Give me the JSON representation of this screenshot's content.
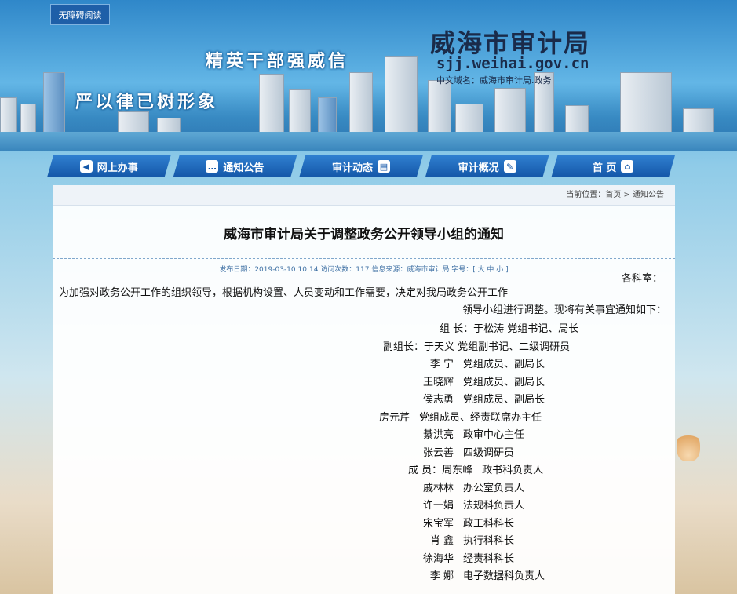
{
  "header": {
    "accessibility_label": "无障碍阅读",
    "site_name": "威海市审计局",
    "domain": "sjj.weihai.gov.cn",
    "cn_domain": "中文域名：威海市审计局.政务",
    "slogan_1": "精英干部强威信",
    "slogan_2": "严以律已树形象"
  },
  "nav": {
    "items": [
      {
        "label": "首  页",
        "icon": "home-icon"
      },
      {
        "label": "审计概况",
        "icon": "profile-icon"
      },
      {
        "label": "审计动态",
        "icon": "book-icon"
      },
      {
        "label": "通知公告",
        "icon": "chat-icon"
      },
      {
        "label": "网上办事",
        "icon": "speaker-icon"
      }
    ]
  },
  "breadcrumb": "当前位置：首页 > 通知公告",
  "article": {
    "title": "威海市审计局关于调整政务公开领导小组的通知",
    "meta": "发布日期：2019-03-10 10:14  访问次数：117  信息来源：威海市审计局  字号：[ 大 中 小 ]",
    "greeting": "各科室：",
    "para_1": "为加强对政务公开工作的组织领导，根据机构设置、人员变动和工作需要，决定对我局政务公开工作",
    "para_2": "领导小组进行调整。现将有关事宜通知如下：",
    "leader": "组    长：于松涛    党组书记、局长",
    "deputy": "副组长：于天义    党组副书记、二级调研员",
    "members": [
      {
        "name": "李    宁",
        "role": "党组成员、副局长"
      },
      {
        "name": "王晓辉",
        "role": "党组成员、副局长"
      },
      {
        "name": "侯志勇",
        "role": "党组成员、副局长"
      },
      {
        "name": "房元芹",
        "role": "党组成员、经责联席办主任"
      },
      {
        "name": "綦洪亮",
        "role": "政审中心主任"
      },
      {
        "name": "张云善",
        "role": "四级调研员"
      },
      {
        "name": "成    员：周东峰",
        "role": "政书科负责人"
      },
      {
        "name": "戚林林",
        "role": "办公室负责人"
      },
      {
        "name": "许一娟",
        "role": "法规科负责人"
      },
      {
        "name": "宋宝军",
        "role": "政工科科长"
      },
      {
        "name": "肖    鑫",
        "role": "执行科科长"
      },
      {
        "name": "徐海华",
        "role": "经责科科长"
      },
      {
        "name": "李    娜",
        "role": "电子数据科负责人"
      }
    ]
  }
}
